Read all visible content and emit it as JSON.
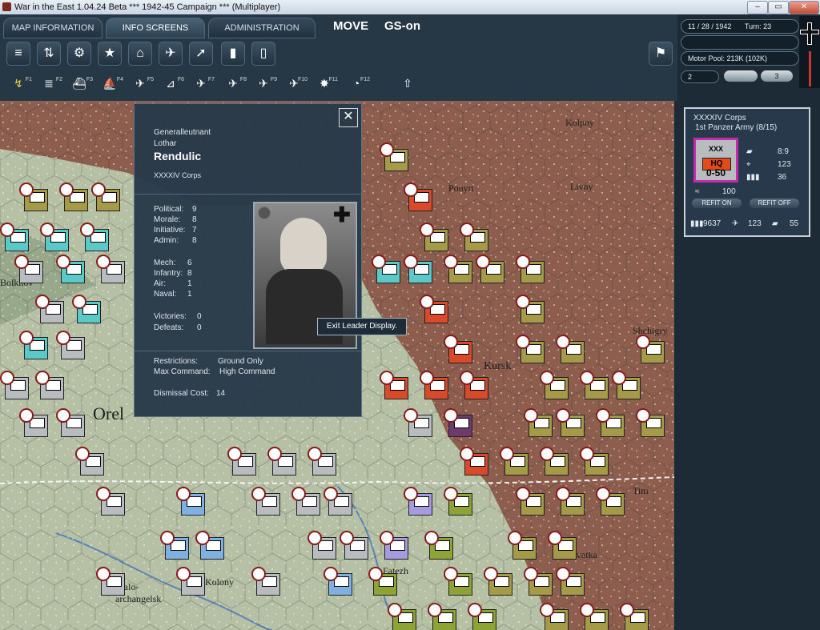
{
  "window": {
    "title": "War in the East 1.04.24 Beta   ***   1942-45 Campaign   ***   (Multiplayer)",
    "buttons": [
      "–",
      "▭",
      "✕"
    ]
  },
  "tabs": [
    {
      "label": "MAP INFORMATION"
    },
    {
      "label": "INFO SCREENS"
    },
    {
      "label": "ADMINISTRATION"
    }
  ],
  "mode": {
    "move": "MOVE",
    "gs": "GS-on"
  },
  "toolbar_row1": [
    {
      "icon": "layers-icon",
      "glyph": "≡"
    },
    {
      "icon": "arrows-icon",
      "glyph": "⇅"
    },
    {
      "icon": "gear-icon",
      "glyph": "⚙"
    },
    {
      "icon": "star-icon",
      "glyph": "★"
    },
    {
      "icon": "factory-icon",
      "glyph": "⌂"
    },
    {
      "icon": "air-icon",
      "glyph": "✈"
    },
    {
      "icon": "rocket-icon",
      "glyph": "➚"
    },
    {
      "icon": "fuel-icon",
      "glyph": "▮"
    },
    {
      "icon": "report-icon",
      "glyph": "▯"
    }
  ],
  "toolbar_row2": [
    {
      "icon": "move-icon",
      "glyph": "↯",
      "key": "F1"
    },
    {
      "icon": "rail-icon",
      "glyph": "≣",
      "key": "F2"
    },
    {
      "icon": "ship-icon",
      "glyph": "⛴",
      "key": "F3"
    },
    {
      "icon": "naval-icon",
      "glyph": "⛵",
      "key": "F4"
    },
    {
      "icon": "air-missions-icon",
      "glyph": "✈",
      "key": "F5"
    },
    {
      "icon": "airbase-icon",
      "glyph": "⊿",
      "key": "F6"
    },
    {
      "icon": "transfer-icon",
      "glyph": "✈",
      "key": "F7"
    },
    {
      "icon": "bomb-city-icon",
      "glyph": "✈",
      "key": "F8"
    },
    {
      "icon": "paradrop-icon",
      "glyph": "✈",
      "key": "F9"
    },
    {
      "icon": "interdict-icon",
      "glyph": "✈",
      "key": "F10"
    },
    {
      "icon": "explosion-icon",
      "glyph": "✸",
      "key": "F11"
    },
    {
      "icon": "dial-icon",
      "glyph": "◔",
      "key": "F12"
    },
    {
      "icon": "up-icon",
      "glyph": "⇧",
      "key": ""
    }
  ],
  "status": {
    "date": "11 / 28 / 1942",
    "turn": "Turn: 23",
    "motor_pool": "Motor Pool: 213K (102K)",
    "value": "2",
    "toggle_label": "3"
  },
  "unit": {
    "name": "XXXXIV Corps",
    "army": "1st Panzer Army (8/15)",
    "echelon": "XXX",
    "type": "HQ",
    "strength": "0-50",
    "tanks_afv": "8:9",
    "guns": "123",
    "men": "36",
    "support": "100",
    "refit_on": "REFIT ON",
    "refit_off": "REFIT OFF",
    "men_total": "9637",
    "air_total": "123",
    "afv_total": "55"
  },
  "leader": {
    "rank": "Generalleutnant",
    "first_name": "Lothar",
    "last_name": "Rendulic",
    "command": "XXXXIV Corps",
    "ratings": [
      {
        "label": "Political:",
        "value": "9"
      },
      {
        "label": "Morale:",
        "value": "8"
      },
      {
        "label": "Initiative:",
        "value": "7"
      },
      {
        "label": "Admin:",
        "value": "8"
      }
    ],
    "combat": [
      {
        "label": "Mech:",
        "value": "6"
      },
      {
        "label": "Infantry:",
        "value": "8"
      },
      {
        "label": "Air:",
        "value": "1"
      },
      {
        "label": "Naval:",
        "value": "1"
      }
    ],
    "record": [
      {
        "label": "Victories:",
        "value": "0"
      },
      {
        "label": "Defeats:",
        "value": "0"
      }
    ],
    "restrictions_label": "Restrictions:",
    "restrictions": "Ground Only",
    "max_command_label": "Max Command:",
    "max_command": "High Command",
    "dismissal_label": "Dismissal Cost:",
    "dismissal": "14",
    "close": "✕",
    "tooltip": "Exit Leader Display."
  },
  "map_labels": [
    {
      "text": "Orel",
      "name": "city-orel"
    },
    {
      "text": "Kursk",
      "name": "city-kursk"
    },
    {
      "text": "Kolpny",
      "name": "town-kolpny"
    },
    {
      "text": "Livny",
      "name": "town-livny"
    },
    {
      "text": "Ponyri",
      "name": "town-ponyri"
    },
    {
      "text": "Fatezh",
      "name": "town-fatezh"
    },
    {
      "text": "Kolony",
      "name": "town-kolony"
    },
    {
      "text": "Malo-archangelsk",
      "name": "town-malo-archangelsk"
    },
    {
      "text": "Tim",
      "name": "town-tim"
    },
    {
      "text": "Shchigry",
      "name": "town-shchigry"
    },
    {
      "text": "Bolkhov",
      "name": "town-bolkhov"
    },
    {
      "text": "Olkhovatka",
      "name": "town-olkhovatka"
    }
  ],
  "colors": {
    "german_corps": "#b9bcbf",
    "german_inf": "#5cc9c9",
    "soviet_inf": "#a49a48",
    "soviet_tank": "#8ea336",
    "hq_border": "#c22bb0",
    "selected_border": "#3b7fd9",
    "badge_red": "#8a1a1a",
    "frontline_red": "#8a5b4c"
  }
}
